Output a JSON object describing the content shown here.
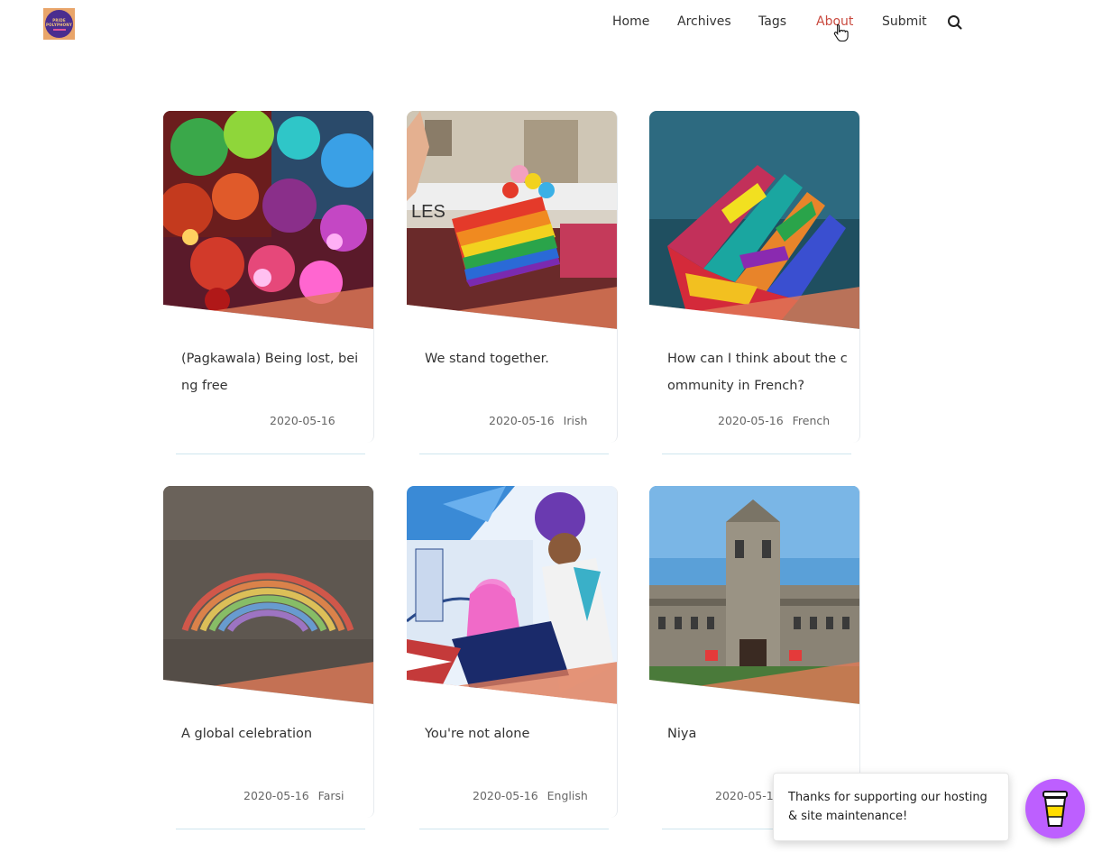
{
  "header": {
    "logo_text_top": "PRIDE",
    "logo_text_bottom": "POLYPHONY",
    "nav": [
      {
        "label": "Home"
      },
      {
        "label": "Archives"
      },
      {
        "label": "Tags"
      },
      {
        "label": "About",
        "active": true
      },
      {
        "label": "Submit"
      }
    ],
    "search_icon": "search-icon"
  },
  "posts": [
    {
      "title": "(Pagkawala) Being lost, being free",
      "date": "2020-05-16",
      "language": "",
      "image": "colorful-bokeh-lights"
    },
    {
      "title": "We stand together.",
      "date": "2020-05-16",
      "language": "Irish",
      "image": "rainbow-flag-parade"
    },
    {
      "title": "How can I think about the community in French?",
      "date": "2020-05-16",
      "language": "French",
      "image": "painted-hand"
    },
    {
      "title": "A global celebration",
      "date": "2020-05-16",
      "language": "Farsi",
      "image": "chalk-rainbow-asphalt"
    },
    {
      "title": "You're not alone",
      "date": "2020-05-16",
      "language": "English",
      "image": "anime-illustration"
    },
    {
      "title": "Niya",
      "date": "2020-05-16",
      "language": "",
      "image": "gothic-university-building"
    }
  ],
  "support": {
    "message": "Thanks for supporting our hosting & site maintenance!",
    "button_icon": "coffee-cup-icon"
  },
  "colors": {
    "accent": "#c94a3f",
    "slant": "#e07a57",
    "coffee": "#bd5fff"
  }
}
